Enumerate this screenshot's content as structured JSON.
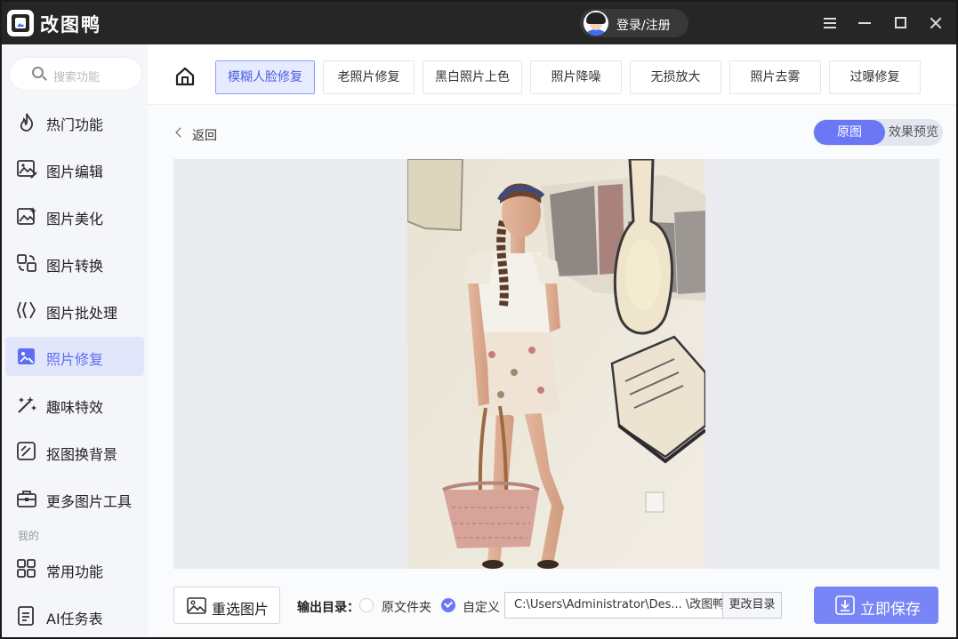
{
  "app": {
    "title": "改图鸭",
    "login_label": "登录/注册"
  },
  "sidebar": {
    "search_placeholder": "搜索功能",
    "items": [
      {
        "label": "热门功能",
        "icon": "flame-icon"
      },
      {
        "label": "图片编辑",
        "icon": "image-edit-icon"
      },
      {
        "label": "图片美化",
        "icon": "image-sparkle-icon"
      },
      {
        "label": "图片转换",
        "icon": "convert-icon"
      },
      {
        "label": "图片批处理",
        "icon": "batch-icon"
      },
      {
        "label": "照片修复",
        "icon": "photo-repair-icon",
        "active": true
      },
      {
        "label": "趣味特效",
        "icon": "magic-wand-icon"
      },
      {
        "label": "抠图换背景",
        "icon": "cutout-icon"
      },
      {
        "label": "更多图片工具",
        "icon": "toolbox-icon"
      }
    ],
    "section_label": "我的",
    "my_items": [
      {
        "label": "常用功能",
        "icon": "grid-icon"
      },
      {
        "label": "AI任务表",
        "icon": "document-icon"
      }
    ]
  },
  "tabs": [
    {
      "label": "模糊人脸修复",
      "active": true
    },
    {
      "label": "老照片修复"
    },
    {
      "label": "黑白照片上色"
    },
    {
      "label": "照片降噪"
    },
    {
      "label": "无损放大"
    },
    {
      "label": "照片去雾"
    },
    {
      "label": "过曝修复"
    }
  ],
  "toolbar": {
    "back_label": "返回",
    "toggle_original": "原图",
    "toggle_preview": "效果预览"
  },
  "bottom": {
    "reselect_label": "重选图片",
    "output_label": "输出目录：",
    "option_original": "原文件夹",
    "option_custom": "自定义",
    "path_value": "C:\\Users\\Administrator\\Des... \\改图鸭",
    "change_dir_label": "更改目录",
    "save_label": "立即保存"
  },
  "colors": {
    "accent": "#6a78f6",
    "titlebar": "#262626",
    "sidebar_bg": "#f4f6f9",
    "active_bg": "#e2e6fb"
  }
}
